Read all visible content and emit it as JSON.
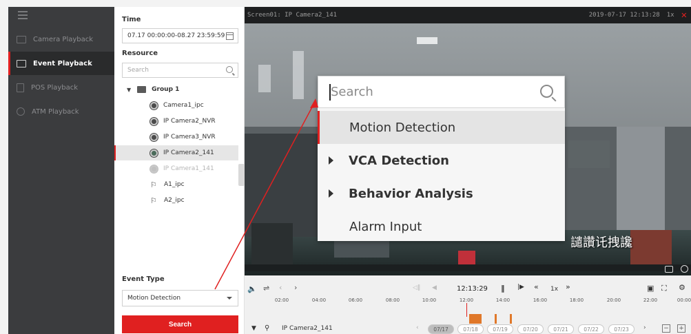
{
  "nav": {
    "items": [
      {
        "label": "Camera Playback",
        "icon": "camera-playback-icon"
      },
      {
        "label": "Event Playback",
        "icon": "event-playback-icon"
      },
      {
        "label": "POS Playback",
        "icon": "pos-playback-icon"
      },
      {
        "label": "ATM Playback",
        "icon": "atm-playback-icon"
      }
    ]
  },
  "panel": {
    "time_title": "Time",
    "time_value": "07.17 00:00:00-08.27 23:59:59",
    "resource_title": "Resource",
    "search_placeholder": "Search",
    "group_label": "Group 1",
    "cameras": [
      "Camera1_ipc",
      "IP Camera2_NVR",
      "IP Camera3_NVR",
      "IP Camera2_141",
      "IP Camera1_141"
    ],
    "alarms": [
      "A1_ipc",
      "A2_ipc"
    ],
    "event_type_title": "Event Type",
    "event_type_value": "Motion Detection",
    "search_button": "Search"
  },
  "video": {
    "screen_title": "Screen01: IP Camera2_141",
    "timestamp": "2019-07-17 12:13:28",
    "speed": "1x",
    "overlay_text": "譴讚讬拽讒"
  },
  "dropdown": {
    "search_placeholder": "Search",
    "items": [
      {
        "label": "Motion Detection",
        "highlighted": true
      },
      {
        "label": "VCA Detection",
        "expandable": true
      },
      {
        "label": "Behavior Analysis",
        "expandable": true
      },
      {
        "label": "Alarm Input"
      }
    ]
  },
  "controls": {
    "current_time": "12:13:29",
    "speed": "1x",
    "timeline_ticks": [
      "02:00",
      "04:00",
      "06:00",
      "08:00",
      "10:00",
      "12:00",
      "14:00",
      "16:00",
      "18:00",
      "20:00",
      "22:00",
      "00:00"
    ],
    "camera_name": "IP Camera2_141",
    "dates": [
      "07/17",
      "07/18",
      "07/19",
      "07/20",
      "07/21",
      "07/22",
      "07/23"
    ],
    "minus": "−",
    "plus": "+"
  },
  "colors": {
    "accent": "#e02020",
    "nav_bg": "#3b3c3e",
    "event_bar": "#e0782a"
  }
}
